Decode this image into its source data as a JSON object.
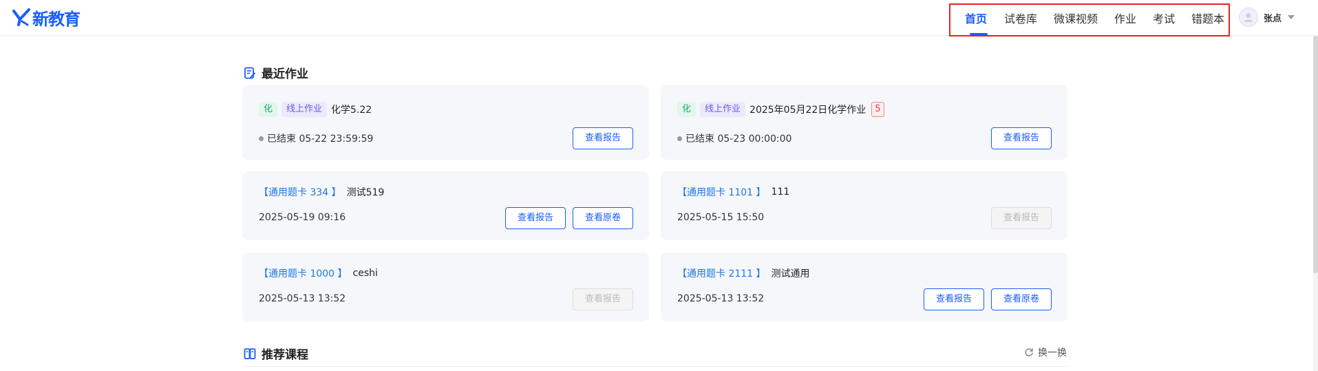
{
  "header": {
    "logo_text": "新教育",
    "nav": [
      {
        "label": "首页",
        "active": true
      },
      {
        "label": "试卷库",
        "active": false
      },
      {
        "label": "微课视频",
        "active": false
      },
      {
        "label": "作业",
        "active": false
      },
      {
        "label": "考试",
        "active": false
      },
      {
        "label": "错题本",
        "active": false
      }
    ],
    "user_name": "张点",
    "accent_color": "#1a5cff",
    "highlight_box_color": "#e0241b"
  },
  "recent": {
    "title": "最近作业",
    "cards": [
      {
        "subject": "化",
        "type": "线上作业",
        "title": "化学5.22",
        "status": "已结束 05-22 23:59:59",
        "buttons": [
          "查看报告"
        ]
      },
      {
        "subject": "化",
        "type": "线上作业",
        "title": "2025年05月22日化学作业",
        "badge": "5",
        "status": "已结束 05-23 00:00:00",
        "buttons": [
          "查看报告"
        ]
      },
      {
        "card_label": "通用题卡 334",
        "title": "测试519",
        "date": "2025-05-19 09:16",
        "buttons": [
          "查看报告",
          "查看原卷"
        ]
      },
      {
        "card_label": "通用题卡 1101",
        "title": "111",
        "date": "2025-05-15 15:50",
        "buttons": [
          "查看报告"
        ],
        "disabled": true
      },
      {
        "card_label": "通用题卡 1000",
        "title": "ceshi",
        "date": "2025-05-13 13:52",
        "buttons": [
          "查看报告"
        ],
        "disabled": true
      },
      {
        "card_label": "通用题卡 2111",
        "title": "测试通用",
        "date": "2025-05-13 13:52",
        "buttons": [
          "查看报告",
          "查看原卷"
        ]
      }
    ]
  },
  "recommend": {
    "title": "推荐课程",
    "refresh_label": "换一换"
  },
  "icons": {
    "logo": "logo-check-icon",
    "avatar": "user-avatar-icon",
    "recent": "homework-doc-icon",
    "recommend": "course-book-icon",
    "refresh": "refresh-icon"
  }
}
